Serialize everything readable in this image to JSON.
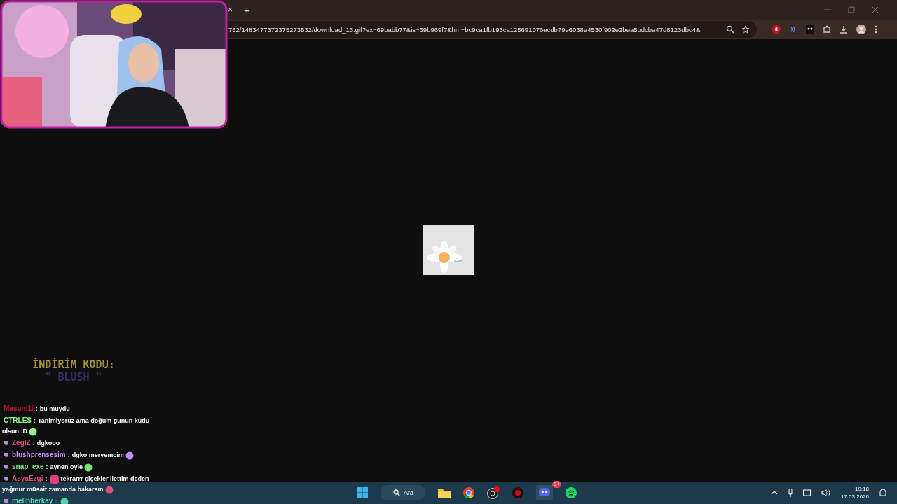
{
  "browser": {
    "tab_close": "×",
    "new_tab": "+",
    "url": "752/1483477372375273532/download_13.gif?ex=69babb77&is=69b969f7&hm=bc9ca1fb193ca125691076ecdb79e6038e4530f902e2bea5bdcba47d8123dbc4&"
  },
  "promo": {
    "title": "İNDİRİM KODU:",
    "code": "\" BLUSH \""
  },
  "chat": [
    {
      "user": "Masum1i",
      "color": "#c8102e",
      "badge": false,
      "sep": ":",
      "text": "bu muydu",
      "emote_before": false,
      "emote_after": false
    },
    {
      "user": "CTRLES",
      "color": "#8ef08a",
      "badge": false,
      "sep": ":",
      "text": "Tanimiyoruz ama doğum günün kutlu",
      "text_2": "olsun :D",
      "emote_before": false,
      "emote_after": true
    },
    {
      "user": "ZegIZ",
      "color": "#e0507a",
      "badge": true,
      "sep": ":",
      "text": "dgkooo",
      "emote_before": false,
      "emote_after": false
    },
    {
      "user": "blushprensesim",
      "color": "#c58cf5",
      "badge": true,
      "sep": ":",
      "text": "dgko meryemcim",
      "emote_before": false,
      "emote_after": true
    },
    {
      "user": "snap_exe",
      "color": "#7ee07a",
      "badge": true,
      "sep": ":",
      "text": "aynen öyle",
      "emote_before": false,
      "emote_after": true
    },
    {
      "user": "AsyaEzgi",
      "color": "#e0507a",
      "badge": true,
      "sep": ":",
      "text": "tekrarrr çiçekler ilettim dcden",
      "text_2": "yağmur müsait zamanda bakarsın",
      "emote_before": true,
      "emote_after": true
    },
    {
      "user": "melihberkay",
      "color": "#4fd6b0",
      "badge": true,
      "sep": ":",
      "emote_before": false,
      "emote_after": true
    }
  ],
  "taskbar": {
    "search": "Ara",
    "discord_badge": "9+",
    "time": "19:18",
    "date": "17.03.2026"
  }
}
